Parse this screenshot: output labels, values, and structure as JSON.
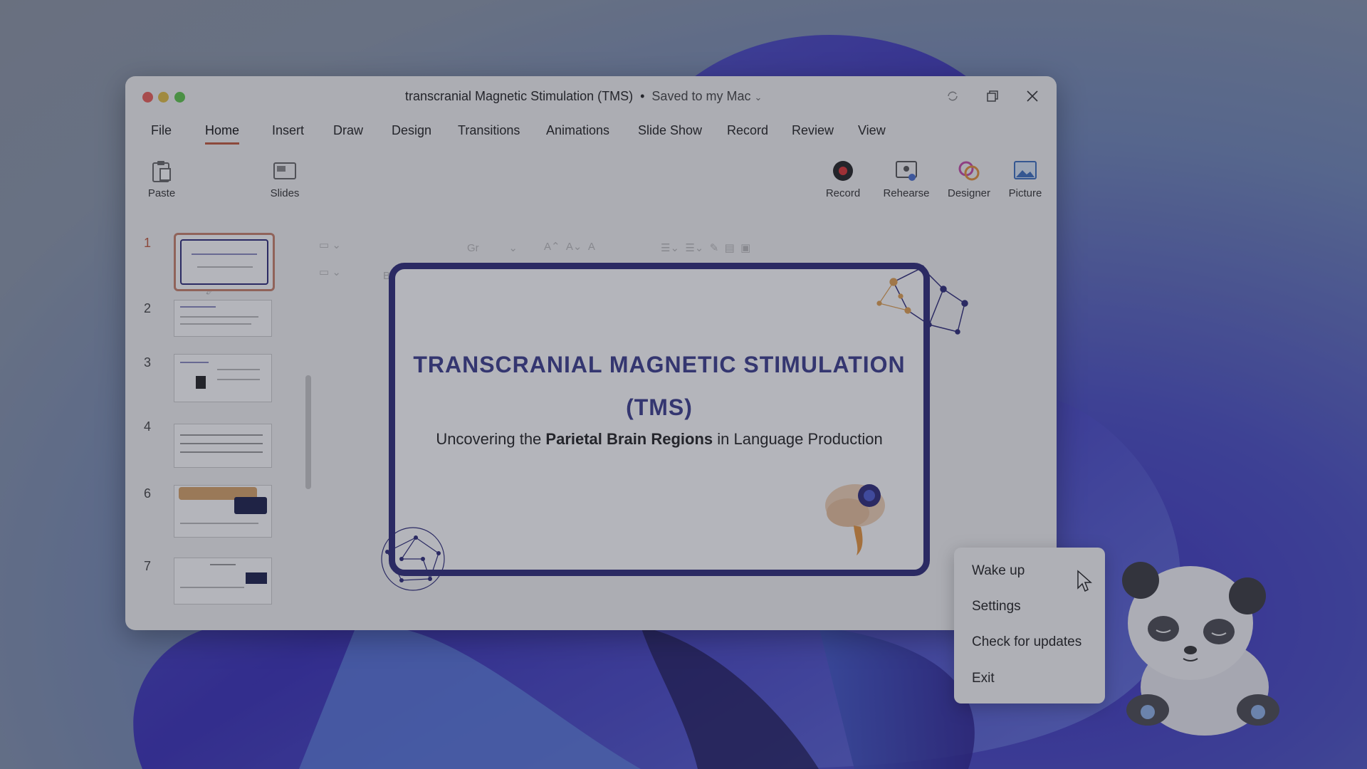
{
  "window": {
    "doc_title": "transcranial Magnetic Stimulation (TMS)",
    "separator": "•",
    "save_status": "Saved to my Mac",
    "save_chevron": "⌄"
  },
  "menu": {
    "items": [
      "File",
      "Home",
      "Insert",
      "Draw",
      "Design",
      "Transitions",
      "Animations",
      "Slide Show",
      "Record",
      "Review",
      "View"
    ],
    "active": "Home"
  },
  "ribbon": {
    "paste": "Paste",
    "slides": "Slides",
    "record": "Record",
    "rehearse": "Rehearse",
    "designer": "Designer",
    "picture": "Picture"
  },
  "thumbnails": {
    "numbers": [
      "1",
      "2",
      "3",
      "4",
      "6",
      "7"
    ],
    "selected": "1"
  },
  "slide": {
    "title_line1": "TRANSCRANIAL MAGNETIC STIMULATION",
    "title_line2": "(TMS)",
    "subtitle_pre": "Uncovering the ",
    "subtitle_bold": "Parietal Brain Regions",
    "subtitle_post": " in Language Production"
  },
  "context_menu": {
    "items": [
      "Wake up",
      "Settings",
      "Check for updates",
      "Exit"
    ]
  },
  "icons": {
    "close": "close-icon",
    "restore": "restore-icon",
    "sync": "sync-icon"
  }
}
